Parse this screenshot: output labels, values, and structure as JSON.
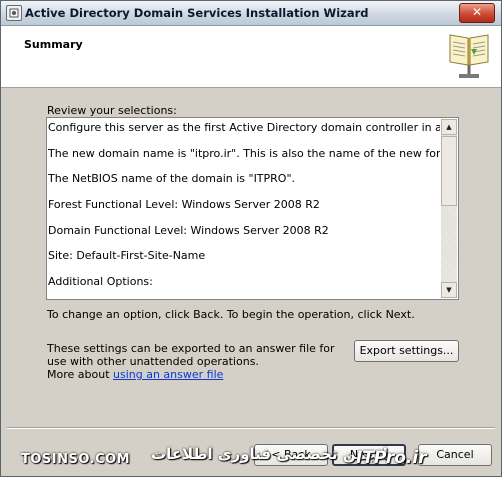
{
  "window": {
    "title": "Active Directory Domain Services Installation Wizard",
    "close_glyph": "✕"
  },
  "header": {
    "title": "Summary",
    "icon": "wizard-book-icon"
  },
  "review_label": "Review your selections:",
  "summary_lines": [
    "Configure this server as the first Active Directory domain controller in a new forest.",
    "The new domain name is \"itpro.ir\". This is also the name of the new forest.",
    "The NetBIOS name of the domain is \"ITPRO\".",
    "Forest Functional Level: Windows Server 2008 R2",
    "Domain Functional Level: Windows Server 2008 R2",
    "Site: Default-First-Site-Name",
    "Additional Options:"
  ],
  "change_text": "To change an option, click Back. To begin the operation, click Next.",
  "export_text": "These settings can be exported to an answer file for use with other unattended operations.",
  "more_prefix": "More about",
  "more_link": "using an answer file",
  "buttons": {
    "export": "Export settings...",
    "back": "< Back",
    "next": "Next >",
    "cancel": "Cancel"
  },
  "watermarks": {
    "left": "TOSINSO.COM",
    "center": "انجمن تخصصی فناوری اطلاعات",
    "right": "ITPro.ir"
  },
  "colors": {
    "link": "#0b3bd1",
    "dialog_bg": "#d4d0c8",
    "close_button": "#cf4b33"
  }
}
